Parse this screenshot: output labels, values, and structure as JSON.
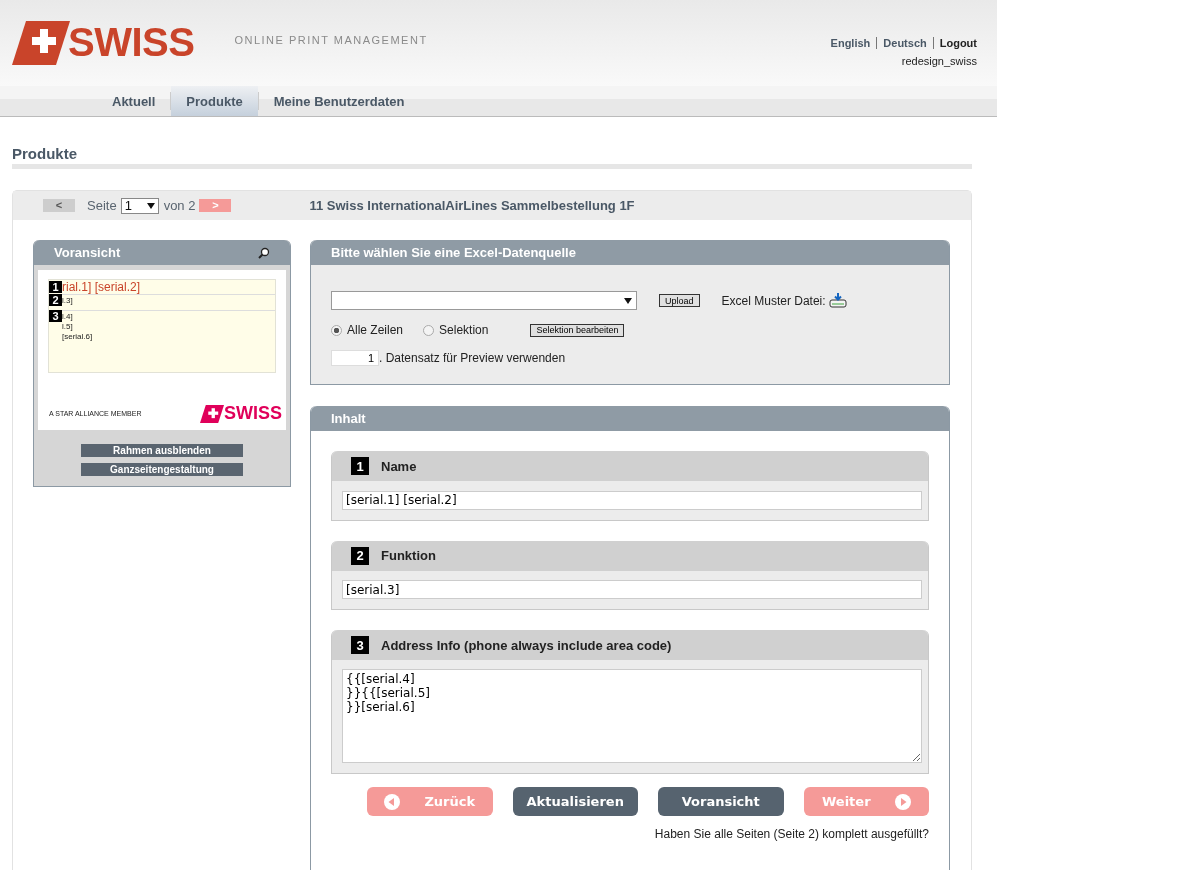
{
  "header": {
    "logo": "SWISS",
    "tagline": "ONLINE PRINT MANAGEMENT",
    "links": [
      {
        "label": "English",
        "bold": false
      },
      {
        "label": "Deutsch",
        "bold": false
      },
      {
        "label": "Logout",
        "bold": true
      }
    ],
    "user": "redesign_swiss"
  },
  "nav": [
    {
      "label": "Aktuell",
      "selected": false
    },
    {
      "label": "Produkte",
      "selected": true
    },
    {
      "label": "Meine Benutzerdaten",
      "selected": false
    }
  ],
  "section_title": "Produkte",
  "pager": {
    "prev": "<",
    "prev_disabled": true,
    "page_label": "Seite",
    "page": "1",
    "of": "von 2",
    "next": ">",
    "next_disabled": false,
    "title": "11 Swiss InternationalAirLines Sammelbestellung 1F"
  },
  "preview": {
    "title": "Voransicht",
    "lines": [
      {
        "badge": "1",
        "text": "rial.1] [serial.2]",
        "kind": "title"
      },
      {
        "badge": "2",
        "text": "l.3]",
        "kind": "small"
      },
      {
        "badge": "3",
        "text": "l.4]",
        "kind": "small"
      },
      {
        "text": "l.5]",
        "kind": "small"
      },
      {
        "text": "[serial.6]",
        "kind": "small"
      }
    ],
    "alliance": "A STAR ALLIANCE MEMBER",
    "logo": "SWISS",
    "buttons": [
      "Rahmen ausblenden",
      "Ganzseitengestaltung"
    ]
  },
  "datasource": {
    "title": "Bitte wählen Sie eine Excel-Datenquelle",
    "upload": "Upload",
    "sample_label": "Excel Muster Datei:",
    "options": [
      {
        "label": "Alle Zeilen",
        "selected": true
      },
      {
        "label": "Selektion",
        "selected": false
      }
    ],
    "edit_selection": "Selektion bearbeiten",
    "record": "1",
    "record_label": ". Datensatz für Preview verwenden"
  },
  "content": {
    "title": "Inhalt",
    "fields": [
      {
        "number": "1",
        "label": "Name",
        "value": "[serial.1] [serial.2]",
        "kind": "line"
      },
      {
        "number": "2",
        "label": "Funktion",
        "value": "[serial.3]",
        "kind": "line"
      },
      {
        "number": "3",
        "label": "Address Info (phone always include area code)",
        "value": "{{[serial.4]\n}}{{[serial.5]\n}}[serial.6]",
        "kind": "area"
      }
    ]
  },
  "actions": [
    {
      "label": "Zurück",
      "kind": "back"
    },
    {
      "label": "Aktualisieren",
      "kind": "action"
    },
    {
      "label": "Voransicht",
      "kind": "action"
    },
    {
      "label": "Weiter",
      "kind": "next"
    }
  ],
  "footer_note": "Haben Sie alle Seiten (Seite 2) komplett ausgefüllt?"
}
